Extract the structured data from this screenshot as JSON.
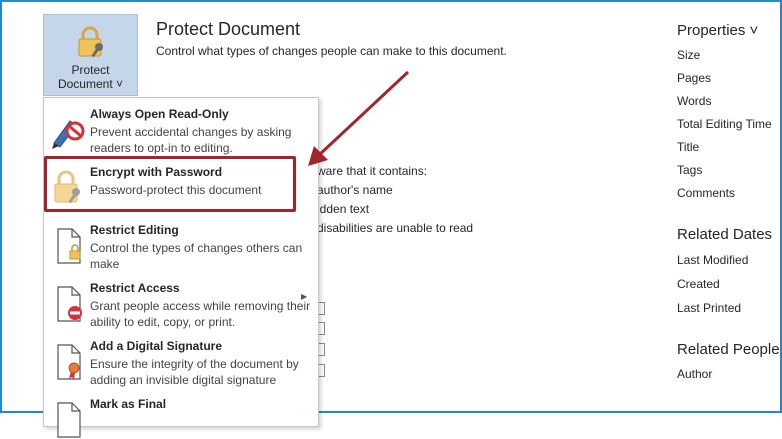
{
  "protect_button": {
    "line1": "Protect",
    "line2": "Document ˅"
  },
  "section": {
    "title": "Protect Document",
    "description": "Control what types of changes people can make to this document."
  },
  "background_text": {
    "line1": "ware that it contains:",
    "line2": "author's name",
    "line3": "idden text",
    "line4": "disabilities are unable to read"
  },
  "properties": {
    "header": "Properties ˅",
    "items": [
      "Size",
      "Pages",
      "Words",
      "Total Editing Time",
      "Title",
      "Tags",
      "Comments"
    ]
  },
  "related_dates": {
    "header": "Related Dates",
    "items": [
      "Last Modified",
      "Created",
      "Last Printed"
    ]
  },
  "related_people": {
    "header": "Related People",
    "items": [
      "Author"
    ]
  },
  "menu": {
    "items": [
      {
        "title": "Always Open Read-Only",
        "desc": "Prevent accidental changes by asking readers to opt-in to editing.",
        "icon": "pen-no-icon"
      },
      {
        "title": "Encrypt with Password",
        "desc": "Password-protect this document",
        "icon": "lock-key-icon"
      },
      {
        "title": "Restrict Editing",
        "desc": "Control the types of changes others can make",
        "icon": "document-lock-icon"
      },
      {
        "title": "Restrict Access",
        "desc": "Grant people access while removing their ability to edit, copy, or print.",
        "icon": "document-restrict-icon"
      },
      {
        "title": "Add a Digital Signature",
        "desc": "Ensure the integrity of the document by adding an invisible digital signature",
        "icon": "document-ribbon-icon"
      },
      {
        "title": "Mark as Final",
        "desc": "",
        "icon": "document-final-icon"
      }
    ]
  },
  "colors": {
    "highlight": "#a0262a",
    "button_bg": "#c5d5ea",
    "frame": "#1e88d0"
  }
}
